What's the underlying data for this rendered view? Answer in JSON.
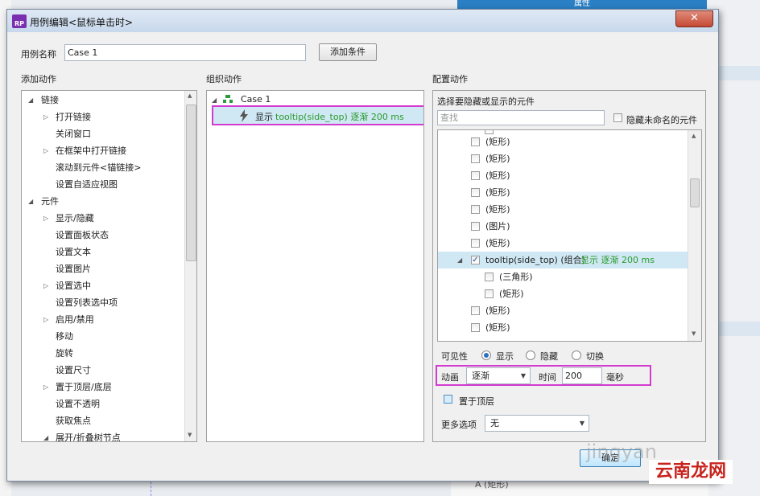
{
  "background": {
    "top_tab": "属性",
    "bottom_item": "A (矩形)"
  },
  "dialog": {
    "title": "用例编辑<鼠标单击时>",
    "close": "✕",
    "case_name_label": "用例名称",
    "case_name_value": "Case 1",
    "add_condition": "添加条件"
  },
  "add_actions": {
    "header": "添加动作",
    "items": [
      {
        "label": "链接",
        "level": 0,
        "expander": "open"
      },
      {
        "label": "打开链接",
        "level": 1,
        "expander": "closed"
      },
      {
        "label": "关闭窗口",
        "level": 1,
        "expander": ""
      },
      {
        "label": "在框架中打开链接",
        "level": 1,
        "expander": "closed"
      },
      {
        "label": "滚动到元件<锚链接>",
        "level": 1,
        "expander": ""
      },
      {
        "label": "设置自适应视图",
        "level": 1,
        "expander": ""
      },
      {
        "label": "元件",
        "level": 0,
        "expander": "open"
      },
      {
        "label": "显示/隐藏",
        "level": 1,
        "expander": "closed"
      },
      {
        "label": "设置面板状态",
        "level": 1,
        "expander": ""
      },
      {
        "label": "设置文本",
        "level": 1,
        "expander": ""
      },
      {
        "label": "设置图片",
        "level": 1,
        "expander": ""
      },
      {
        "label": "设置选中",
        "level": 1,
        "expander": "closed"
      },
      {
        "label": "设置列表选中项",
        "level": 1,
        "expander": ""
      },
      {
        "label": "启用/禁用",
        "level": 1,
        "expander": "closed"
      },
      {
        "label": "移动",
        "level": 1,
        "expander": ""
      },
      {
        "label": "旋转",
        "level": 1,
        "expander": ""
      },
      {
        "label": "设置尺寸",
        "level": 1,
        "expander": ""
      },
      {
        "label": "置于顶层/底层",
        "level": 1,
        "expander": "closed"
      },
      {
        "label": "设置不透明",
        "level": 1,
        "expander": ""
      },
      {
        "label": "获取焦点",
        "level": 1,
        "expander": ""
      },
      {
        "label": "展开/折叠树节点",
        "level": 1,
        "expander": "open"
      }
    ]
  },
  "organize_actions": {
    "header": "组织动作",
    "case_label": "Case 1",
    "action_prefix": "显示",
    "action_target": "tooltip(side_top) 逐渐 200 ms"
  },
  "configure_actions": {
    "header": "配置动作",
    "subheader": "选择要隐藏或显示的元件",
    "search_placeholder": "查找",
    "hide_unnamed_label": "隐藏未命名的元件",
    "widgets": [
      {
        "label": "(矩形)",
        "level": 1,
        "checked": false,
        "extra": ""
      },
      {
        "label": "(矩形)",
        "level": 1,
        "checked": false,
        "extra": ""
      },
      {
        "label": "(矩形)",
        "level": 1,
        "checked": false,
        "extra": ""
      },
      {
        "label": "(矩形)",
        "level": 1,
        "checked": false,
        "extra": ""
      },
      {
        "label": "(矩形)",
        "level": 1,
        "checked": false,
        "extra": ""
      },
      {
        "label": "(图片)",
        "level": 1,
        "checked": false,
        "extra": ""
      },
      {
        "label": "(矩形)",
        "level": 1,
        "checked": false,
        "extra": ""
      },
      {
        "label": "tooltip(side_top) (组合)",
        "level": 1,
        "checked": true,
        "extra": "显示 逐渐 200 ms",
        "selected": true
      },
      {
        "label": "(三角形)",
        "level": 2,
        "checked": false,
        "extra": ""
      },
      {
        "label": "(矩形)",
        "level": 2,
        "checked": false,
        "extra": ""
      },
      {
        "label": "(矩形)",
        "level": 1,
        "checked": false,
        "extra": ""
      },
      {
        "label": "(矩形)",
        "level": 1,
        "checked": false,
        "extra": ""
      }
    ],
    "visibility_label": "可见性",
    "visibility_options": [
      "显示",
      "隐藏",
      "切换"
    ],
    "visibility_selected": "显示",
    "animation_label": "动画",
    "animation_value": "逐渐",
    "time_label": "时间",
    "time_value": "200",
    "time_unit": "毫秒",
    "bring_to_front_label": "置于顶层",
    "more_options_label": "更多选项",
    "more_options_value": "无",
    "ok_button": "确定"
  },
  "watermark": {
    "site": "云南龙网",
    "faint": "jingyan"
  }
}
